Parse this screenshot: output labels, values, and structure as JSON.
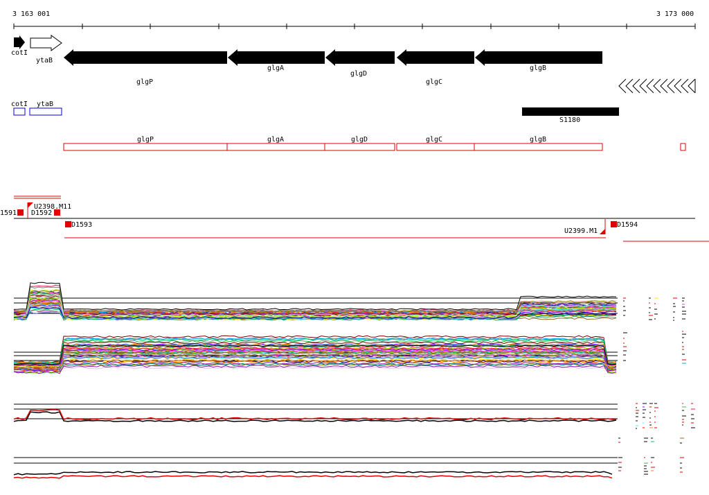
{
  "ruler": {
    "start_label": "3 163 001",
    "end_label": "3 173 000"
  },
  "genes_track": {
    "genes": [
      {
        "name": "cotI",
        "strand": "+",
        "style": "filled"
      },
      {
        "name": "ytaB",
        "strand": "+",
        "style": "outline"
      },
      {
        "name": "glgP",
        "strand": "-",
        "style": "filled"
      },
      {
        "name": "glgA",
        "strand": "-",
        "style": "filled"
      },
      {
        "name": "glgD",
        "strand": "-",
        "style": "filled"
      },
      {
        "name": "glgC",
        "strand": "-",
        "style": "filled"
      },
      {
        "name": "glgB",
        "strand": "-",
        "style": "filled"
      }
    ]
  },
  "boxes_track": {
    "blue_boxes": [
      "cotI",
      "ytaB"
    ],
    "black_bar_label": "S1180",
    "red_boxes": [
      "glgP",
      "glgA",
      "glgD",
      "glgC",
      "glgB"
    ]
  },
  "tss_track": {
    "labels": [
      "1591",
      "U2398.M11",
      "D1592",
      "D1593",
      "U2399.M1",
      "D1594"
    ]
  },
  "colors": {
    "gene_fill": "#000000",
    "blue_box": "#0000cc",
    "red": "#e00000",
    "axis": "#000000"
  },
  "expression_panels": [
    {
      "name": "expression-panel-1"
    },
    {
      "name": "expression-panel-2"
    },
    {
      "name": "expression-panel-3"
    },
    {
      "name": "expression-panel-4"
    }
  ]
}
